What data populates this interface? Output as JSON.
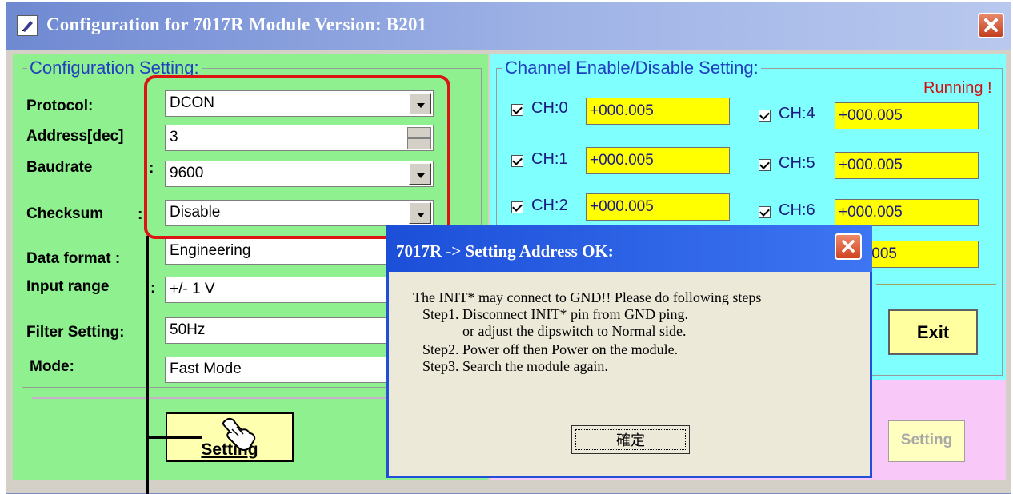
{
  "window": {
    "title": "Configuration for 7017R Module Version: B201"
  },
  "config": {
    "legend": "Configuration Setting:",
    "fields": {
      "protocol": {
        "label": "Protocol:",
        "value": "DCON"
      },
      "address": {
        "label": "Address[dec]",
        "value": "3"
      },
      "baudrate": {
        "label": "Baudrate",
        "value": "9600"
      },
      "checksum": {
        "label": "Checksum",
        "value": "Disable"
      },
      "data_format": {
        "label": "Data format :",
        "value": "Engineering"
      },
      "input_range": {
        "label": "Input range",
        "value": "+/- 1 V"
      },
      "filter": {
        "label": "Filter Setting:",
        "value": "50Hz"
      },
      "mode": {
        "label": "Mode:",
        "value": "Fast Mode"
      }
    },
    "setting_button": "Setting"
  },
  "channels": {
    "legend": "Channel Enable/Disable Setting:",
    "status": "Running !",
    "items": [
      {
        "label": "CH:0",
        "value": "+000.005",
        "checked": true
      },
      {
        "label": "CH:1",
        "value": "+000.005",
        "checked": true
      },
      {
        "label": "CH:2",
        "value": "+000.005",
        "checked": true
      },
      {
        "label": "CH:4",
        "value": "+000.005",
        "checked": true
      },
      {
        "label": "CH:5",
        "value": "+000.005",
        "checked": true
      },
      {
        "label": "CH:6",
        "value": "+000.005",
        "checked": true
      },
      {
        "label": "",
        "value": ".005",
        "checked": false
      }
    ],
    "exit_button": "Exit",
    "setting_button": "Setting"
  },
  "dialog": {
    "title": "7017R -> Setting Address OK:",
    "lines": [
      "The INIT* may connect to GND!! Please do following steps",
      "Step1. Disconnect INIT* pin from GND ping.",
      "or adjust the dipswitch to Normal side.",
      "Step2. Power off then Power on the module.",
      "Step3. Search the module again."
    ],
    "ok_button": "確定"
  },
  "colors": {
    "config_panel": "#8ff08f",
    "channel_panel": "#80ffff",
    "value_box": "#ffff00",
    "highlight": "#dc1414",
    "dialog_title": "#1c4fd8"
  }
}
